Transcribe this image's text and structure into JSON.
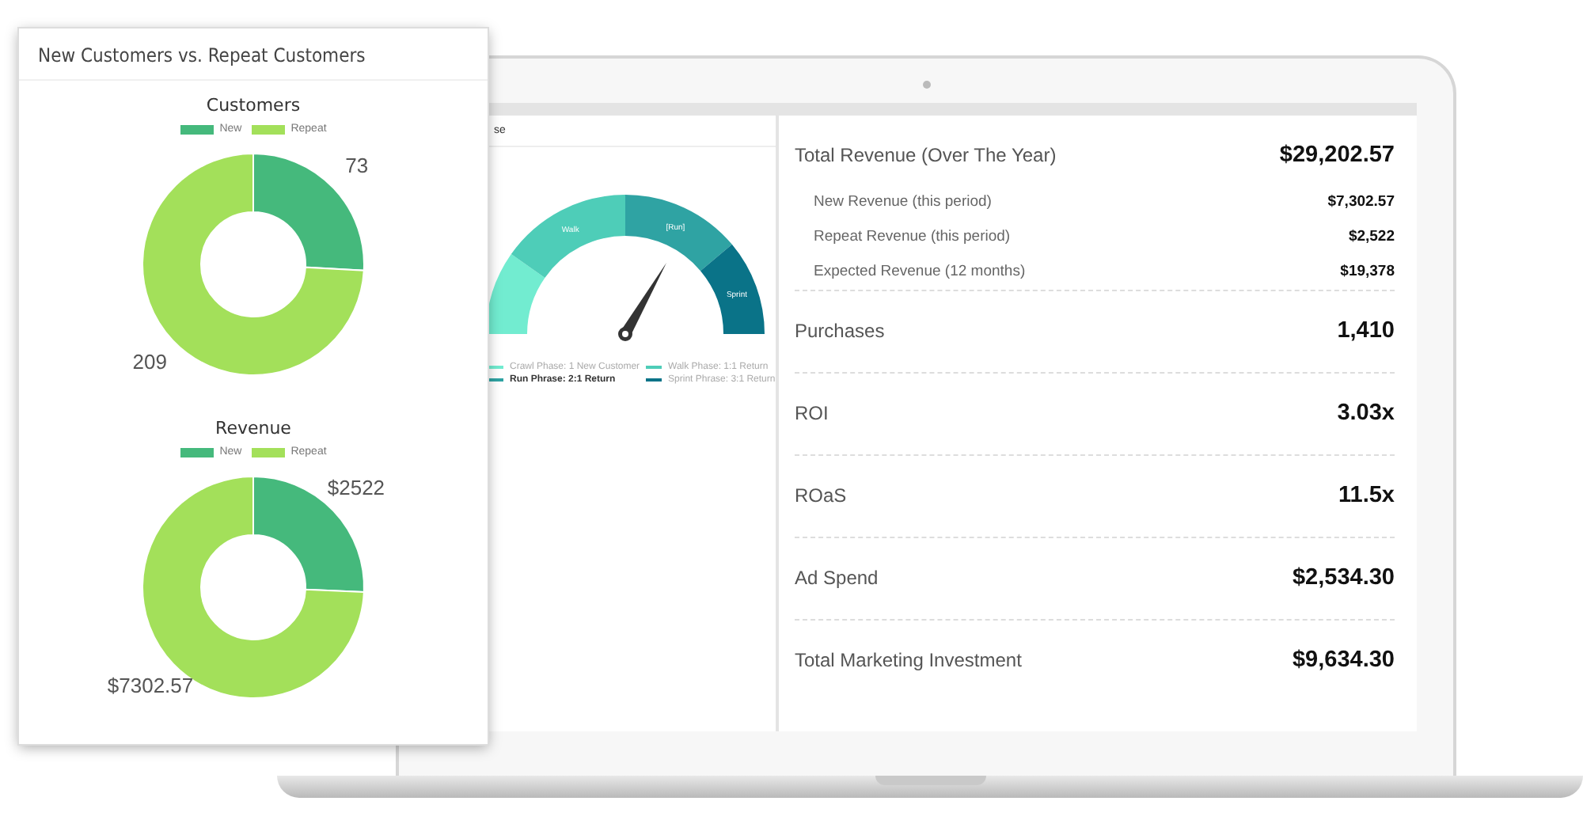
{
  "overlay_card": {
    "title": "New Customers vs. Repeat Customers",
    "charts": [
      {
        "legend": [
          {
            "color": "#45b97c"
          },
          {
            "color": "#a3e05a"
          }
        ],
        "chart_data": {
          "type": "donut",
          "title": "Customers",
          "categories": [
            "New",
            "Repeat"
          ],
          "values": [
            73,
            209
          ],
          "value_labels": [
            "73",
            "209"
          ]
        }
      },
      {
        "legend": [
          {
            "color": "#45b97c"
          },
          {
            "color": "#a3e05a"
          }
        ],
        "chart_data": {
          "type": "donut",
          "title": "Revenue",
          "categories": [
            "New",
            "Repeat"
          ],
          "values": [
            2522,
            7302.57
          ],
          "value_labels": [
            "$2522",
            "$7302.57"
          ]
        }
      }
    ]
  },
  "gauge_panel": {
    "title": "se",
    "segments": [
      {
        "color": "#72ecd0"
      },
      {
        "label": "Walk",
        "color": "#4ecdb8"
      },
      {
        "label": "[Run]",
        "color": "#2fa3a3"
      },
      {
        "label": "Sprint",
        "color": "#0a7388"
      }
    ],
    "legend": [
      {
        "label": "Crawl Phase: 1 New Customer",
        "color": "#72ecd0",
        "selected": false
      },
      {
        "label": "Walk Phase: 1:1 Return",
        "color": "#4ecdb8",
        "selected": false
      },
      {
        "label": "Run Phrase: 2:1 Return",
        "color": "#2fa3a3",
        "selected": true
      },
      {
        "label": "Sprint Phrase: 3:1 Return",
        "color": "#0a7388",
        "selected": false
      }
    ]
  },
  "metrics": [
    {
      "kind": "main",
      "label": "Total Revenue (Over The Year)",
      "value": "$29,202.57"
    },
    {
      "kind": "sub",
      "label": "New Revenue (this period)",
      "value": "$7,302.57"
    },
    {
      "kind": "sub",
      "label": "Repeat Revenue (this period)",
      "value": "$2,522"
    },
    {
      "kind": "sub",
      "label": "Expected Revenue (12 months)",
      "value": "$19,378"
    },
    {
      "kind": "main",
      "label": "Purchases",
      "value": "1,410"
    },
    {
      "kind": "main",
      "label": "ROI",
      "value": "3.03x"
    },
    {
      "kind": "main",
      "label": "ROaS",
      "value": "11.5x"
    },
    {
      "kind": "main",
      "label": "Ad Spend",
      "value": "$2,534.30"
    },
    {
      "kind": "main",
      "label": "Total Marketing Investment",
      "value": "$9,634.30"
    }
  ]
}
